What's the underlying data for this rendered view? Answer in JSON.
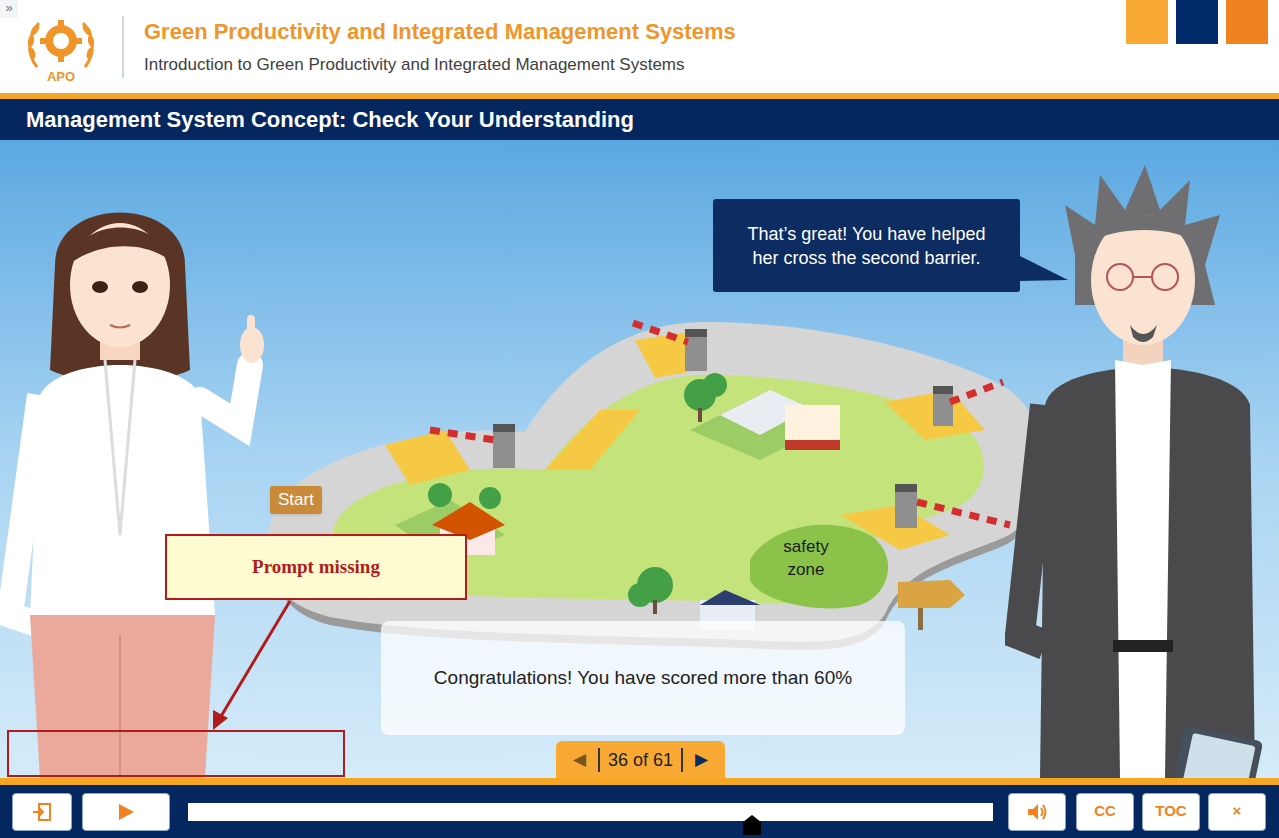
{
  "header": {
    "collapse": "»",
    "logo_text": "APO",
    "title": "Green Productivity and Integrated Management Systems",
    "subtitle": "Introduction to Green Productivity and Integrated Management Systems"
  },
  "slide": {
    "title": "Management System Concept: Check Your Understanding"
  },
  "scene": {
    "speech": "That’s great! You have helped her cross the second barrier.",
    "map_labels": {
      "start": "Start",
      "safety_zone": "safety zone"
    },
    "feedback": "Congratulations! You have scored more than 60%"
  },
  "annotation": {
    "label": "Prompt missing"
  },
  "pager": {
    "prev": "◀",
    "label": "36 of 61",
    "next": "▶"
  },
  "controls": {
    "progress": {
      "level": 0.7
    },
    "buttons": [
      "CC",
      "TOC",
      "×"
    ]
  }
}
